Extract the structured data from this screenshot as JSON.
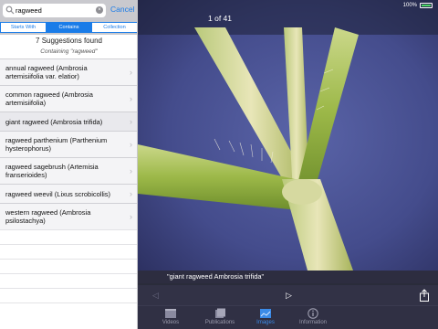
{
  "search": {
    "query": "ragweed",
    "cancel_label": "Cancel"
  },
  "segments": [
    {
      "label": "Starts With",
      "active": false
    },
    {
      "label": "Contains",
      "active": true
    },
    {
      "label": "Collection",
      "active": false
    }
  ],
  "results": {
    "found_text": "7 Suggestions found",
    "containing_text": "Containing \"ragweed\"",
    "items": [
      {
        "label": "annual ragweed (Ambrosia artemisiifolia var. elatior)"
      },
      {
        "label": "common ragweed (Ambrosia artemisiifolia)"
      },
      {
        "label": "giant ragweed (Ambrosia trifida)"
      },
      {
        "label": "ragweed parthenium (Parthenium hysterophorus)"
      },
      {
        "label": "ragweed sagebrush (Artemisia franserioides)"
      },
      {
        "label": "ragweed weevil (Lixus scrobicollis)"
      },
      {
        "label": "western ragweed (Ambrosia psilostachya)"
      }
    ]
  },
  "viewer": {
    "counter": "1 of 41",
    "caption": "\"giant ragweed Ambrosia trifida\"",
    "battery": "100%"
  },
  "tabs": [
    {
      "label": "Videos",
      "icon": "video-icon",
      "active": false
    },
    {
      "label": "Publications",
      "icon": "publications-icon",
      "active": false
    },
    {
      "label": "Images",
      "icon": "images-icon",
      "active": true
    },
    {
      "label": "Information",
      "icon": "info-icon",
      "active": false
    }
  ],
  "colors": {
    "accent": "#1a7ce8",
    "tab_active": "#3b8be8",
    "bar_bg": "#303044"
  }
}
